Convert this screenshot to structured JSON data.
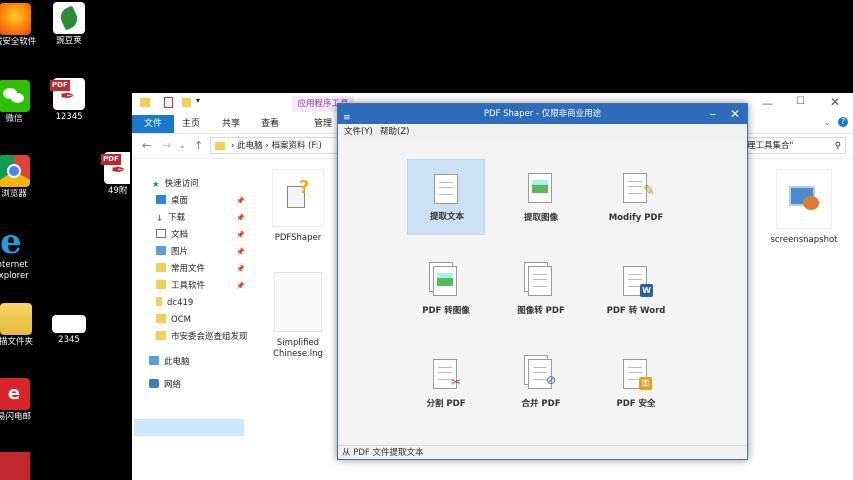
{
  "desktop": {
    "icons": [
      {
        "label": "绒安全软件"
      },
      {
        "label": "豌豆荚"
      },
      {
        "label": "微信"
      },
      {
        "label": "12345"
      },
      {
        "label": "浏览器"
      },
      {
        "label": "49附"
      },
      {
        "label": "Internet Explorer"
      },
      {
        "label": "描文件夹"
      },
      {
        "label": "2345"
      },
      {
        "label": "易闪电邮"
      }
    ]
  },
  "explorer": {
    "tabs": {
      "file": "文件",
      "home": "主页",
      "share": "共享",
      "view": "查看",
      "manage": "管理",
      "context": "应用程序工具"
    },
    "address": {
      "this_pc": "此电脑",
      "path": "档案资料 (F:)"
    },
    "search_placeholder": "理工具集合\"",
    "nav": {
      "quick_access": "快速访问",
      "desktop": "桌面",
      "downloads": "下载",
      "documents": "文档",
      "pictures": "图片",
      "common_files": "常用文件",
      "tools": "工具软件",
      "dc419": "dc419",
      "ocm": "OCM",
      "folder": "市安委会巡查组发现",
      "this_pc": "此电脑",
      "network": "网络"
    },
    "files": {
      "pdfshaper": "PDFShaper",
      "simplified": "Simplified Chinese.lng",
      "screensnapshot": "screensnapshot"
    }
  },
  "pdfshaper": {
    "title": "PDF Shaper - 仅限非商业用途",
    "menu": {
      "file": "文件(Y)",
      "help": "帮助(Z)"
    },
    "tools": {
      "extract_text": "提取文本",
      "extract_images": "提取图像",
      "modify_pdf": "Modify PDF",
      "pdf_to_image": "PDF 转图像",
      "image_to_pdf": "图像转 PDF",
      "pdf_to_word": "PDF 转 Word",
      "split_pdf": "分割 PDF",
      "merge_pdf": "合并 PDF",
      "pdf_security": "PDF 安全"
    },
    "status": "从 PDF 文件提取文本"
  }
}
